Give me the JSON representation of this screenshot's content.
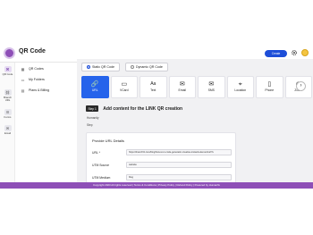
{
  "app": {
    "title": "QR Code"
  },
  "header": {
    "create_label": "Create"
  },
  "rail": {
    "items": [
      {
        "label": "QR Code",
        "icon": "qr-icon",
        "glyph": "⌘"
      },
      {
        "label": "Branch URL",
        "icon": "link-icon",
        "glyph": "⛓"
      },
      {
        "label": "Forms",
        "icon": "forms-icon",
        "glyph": "☰"
      },
      {
        "label": "Email",
        "icon": "email-icon",
        "glyph": "✉"
      }
    ]
  },
  "sidebar": {
    "items": [
      {
        "label": "QR Codes",
        "icon": "grid-icon",
        "glyph": "▦"
      },
      {
        "label": "My Folders",
        "icon": "folder-icon",
        "glyph": "▭"
      },
      {
        "label": "Plans & Billing",
        "icon": "card-icon",
        "glyph": "▤"
      }
    ]
  },
  "main": {
    "qr_types": [
      {
        "label": "Static QR Code",
        "selected": true
      },
      {
        "label": "Dynamic QR Code",
        "selected": false
      }
    ],
    "content_types": [
      {
        "label": "URL",
        "glyph": "🔗",
        "active": true
      },
      {
        "label": "VCard",
        "glyph": "▭"
      },
      {
        "label": "Text",
        "glyph": "Aa"
      },
      {
        "label": "Email",
        "glyph": "✉"
      },
      {
        "label": "SMS",
        "glyph": "✉"
      },
      {
        "label": "Location",
        "glyph": "⌖"
      },
      {
        "label": "Phone",
        "glyph": "▯"
      },
      {
        "label": "Zoom",
        "glyph": "◉"
      }
    ],
    "next_glyph": "›",
    "step": {
      "badge": "Step 1",
      "title": "Add content for the LINK QR creation"
    },
    "crumbs": [
      "Humanity",
      "Step"
    ],
    "form": {
      "title": "Provide URL Details",
      "fields": [
        {
          "label": "URL *",
          "value": "https://branch%.com/blog/how-to-in-code-generator-creative-instantt-element/url?u"
        },
        {
          "label": "UTM Source",
          "value": "website"
        },
        {
          "label": "UTM Medium",
          "value": "blog"
        }
      ]
    }
  },
  "footer": {
    "text": "Copyright 2023 All rights reserved | Terms & Conditions | Privacy Policy | Refund Policy | Powered by Humanfix"
  },
  "colors": {
    "accent": "#8e4fb7",
    "primary": "#2563eb"
  }
}
